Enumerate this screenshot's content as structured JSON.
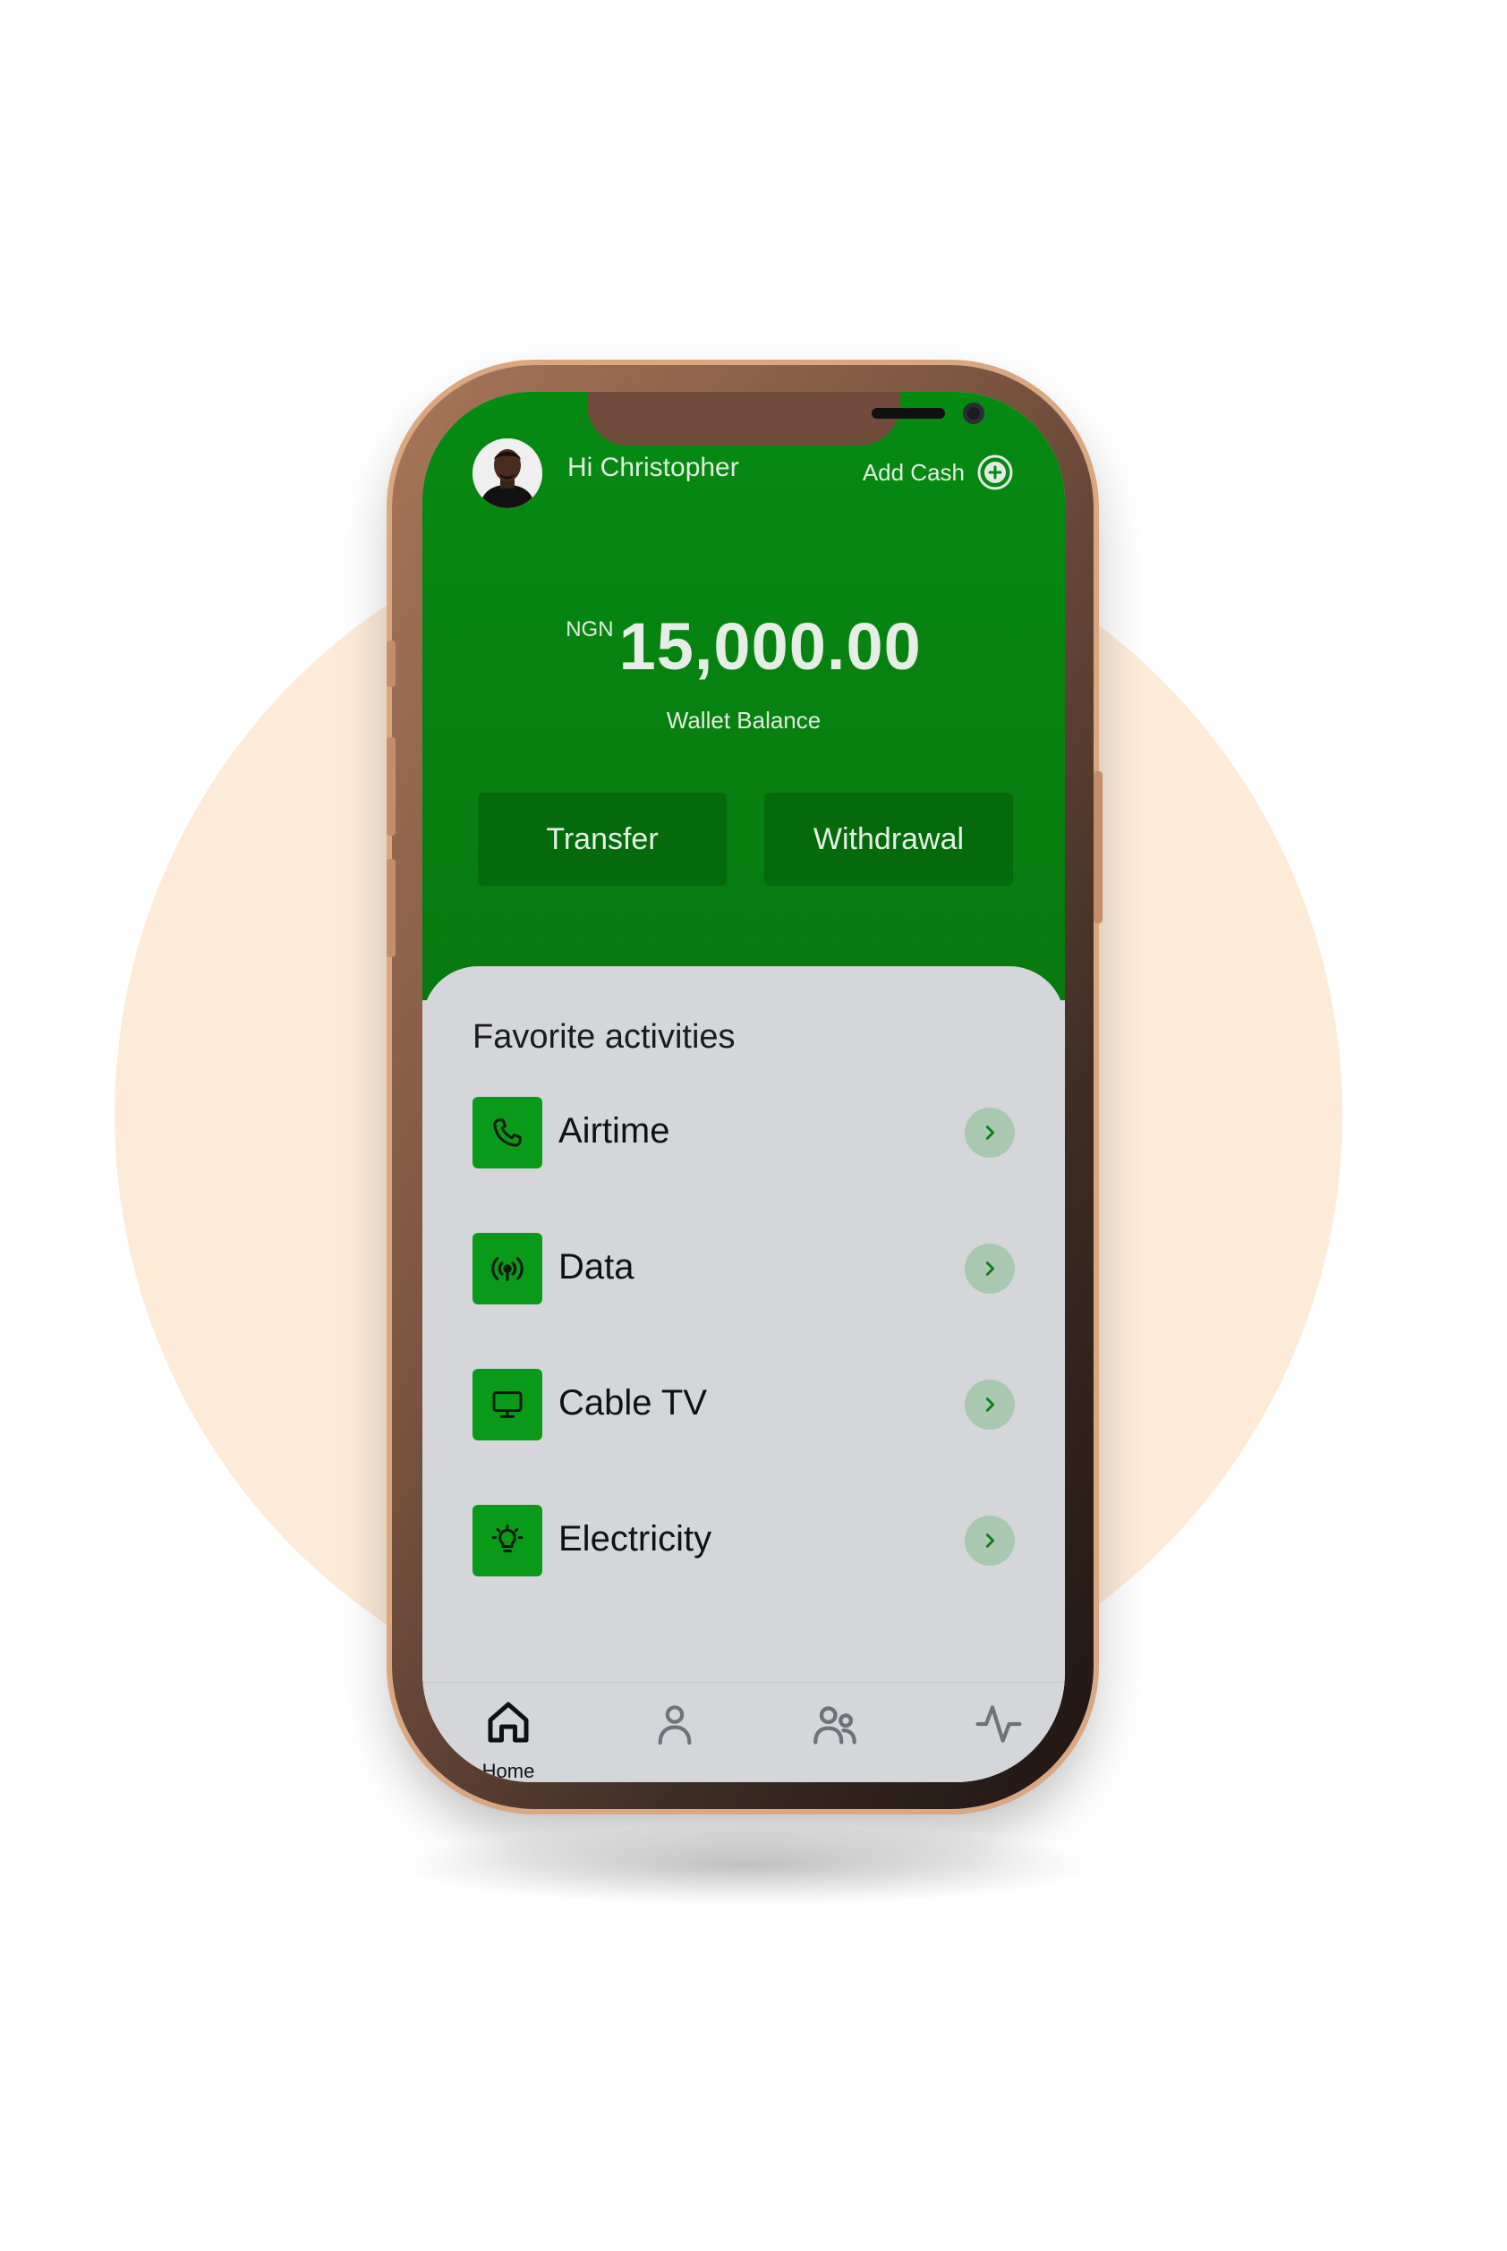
{
  "header": {
    "greeting": "Hi Christopher",
    "add_cash_label": "Add Cash"
  },
  "balance": {
    "currency": "NGN",
    "amount": "15,000.00",
    "label": "Wallet Balance"
  },
  "actions": {
    "transfer": "Transfer",
    "withdrawal": "Withdrawal"
  },
  "favorites": {
    "title": "Favorite activities",
    "items": [
      {
        "label": "Airtime",
        "icon": "phone-icon"
      },
      {
        "label": "Data",
        "icon": "signal-icon"
      },
      {
        "label": "Cable TV",
        "icon": "tv-icon"
      },
      {
        "label": "Electricity",
        "icon": "lightbulb-icon"
      }
    ]
  },
  "nav": {
    "home_label": "Home"
  },
  "colors": {
    "brand_green": "#058a12",
    "button_green": "#056a0b",
    "card_bg": "#d4d6da",
    "chevron_bg": "#a9c8b0",
    "backdrop_circle": "#fdebd8"
  }
}
